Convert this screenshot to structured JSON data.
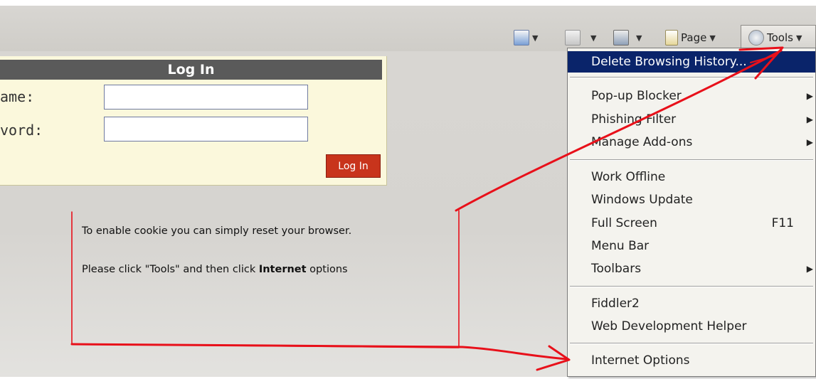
{
  "toolbar": {
    "page_label": "Page",
    "tools_label": "Tools"
  },
  "login": {
    "title": "Log In",
    "username_label": "ame:",
    "password_label": "vord:",
    "button_label": "Log In"
  },
  "instructions": {
    "line1": "To enable cookie you can simply reset your browser.",
    "line2_prefix": "Please click \"Tools\" and then click ",
    "line2_bold": "Internet",
    "line2_suffix": " options"
  },
  "tools_menu": {
    "items": [
      {
        "label": "Delete Browsing History..."
      },
      {
        "label": "Pop-up Blocker",
        "submenu": "▶"
      },
      {
        "label": "Phishing Filter",
        "submenu": "▶"
      },
      {
        "label": "Manage Add-ons",
        "submenu": "▶"
      },
      {
        "label": "Work Offline"
      },
      {
        "label": "Windows Update"
      },
      {
        "label": "Full Screen",
        "shortcut": "F11"
      },
      {
        "label": "Menu Bar"
      },
      {
        "label": "Toolbars",
        "submenu": "▶"
      },
      {
        "label": "Fiddler2"
      },
      {
        "label": "Web Development Helper"
      },
      {
        "label": "Internet Options"
      }
    ]
  },
  "colors": {
    "menu_highlight": "#0a246a",
    "annotation_red": "#e8101a",
    "login_button": "#c8341c"
  }
}
